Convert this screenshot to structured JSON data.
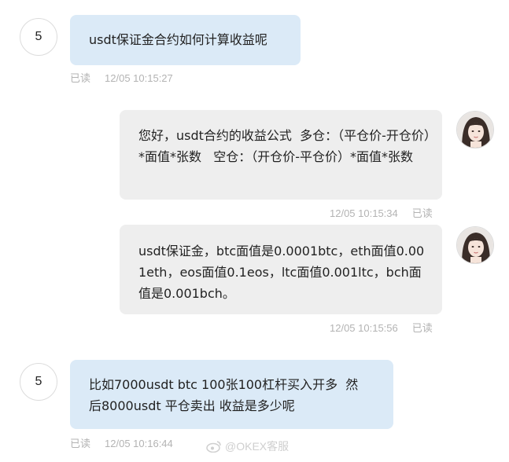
{
  "messages": [
    {
      "avatar_label": "5",
      "text": "usdt保证金合约如何计算收益呢",
      "read_status": "已读",
      "time": "12/05 10:15:27"
    },
    {
      "text": "您好，usdt合约的收益公式  多仓：（平仓价-开仓价）*面值*张数   空仓：（开仓价-平仓价）*面值*张数",
      "time": "12/05 10:15:34",
      "read_status": "已读"
    },
    {
      "text": "usdt保证金，btc面值是0.0001btc，eth面值0.001eth，eos面值0.1eos，ltc面值0.001ltc，bch面值是0.001bch。",
      "time": "12/05 10:15:56",
      "read_status": "已读"
    },
    {
      "avatar_label": "5",
      "text": "比如7000usdt btc 100张100杠杆买入开多  然后8000usdt 平仓卖出 收益是多少呢",
      "read_status": "已读",
      "time": "12/05 10:16:44"
    }
  ],
  "watermark": "@OKEX客服"
}
